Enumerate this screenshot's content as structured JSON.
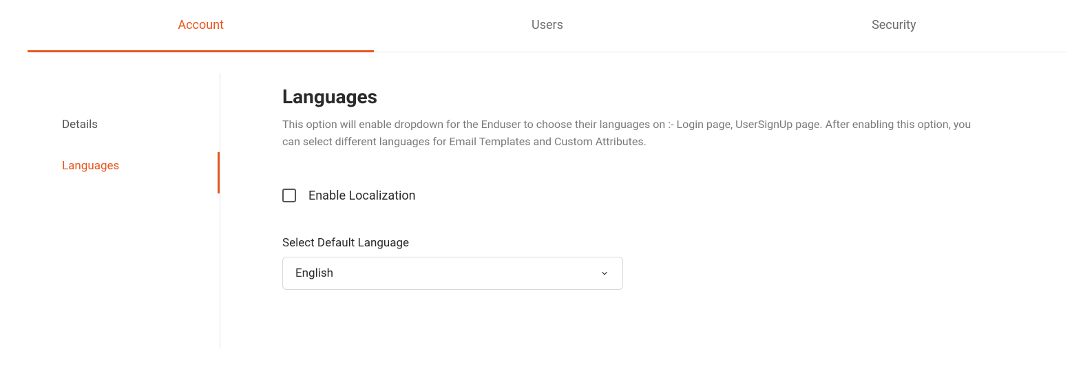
{
  "tabs": [
    {
      "label": "Account",
      "active": true
    },
    {
      "label": "Users",
      "active": false
    },
    {
      "label": "Security",
      "active": false
    }
  ],
  "sidebar": {
    "items": [
      {
        "label": "Details",
        "active": false
      },
      {
        "label": "Languages",
        "active": true
      }
    ]
  },
  "main": {
    "title": "Languages",
    "description": "This option will enable dropdown for the Enduser to choose their languages on :- Login page, UserSignUp page. After enabling this option, you can select different languages for Email Templates and Custom Attributes.",
    "checkbox_label": "Enable Localization",
    "field_label": "Select Default Language",
    "dropdown_value": "English"
  }
}
